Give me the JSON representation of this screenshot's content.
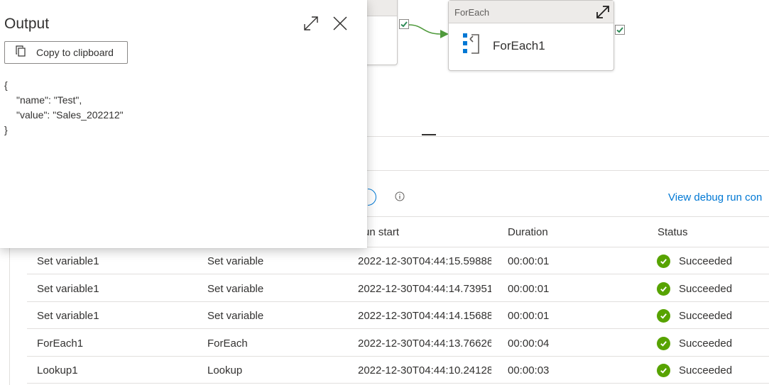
{
  "canvas": {
    "foreach_card": {
      "header_label": "ForEach",
      "activity_name": "ForEach1"
    },
    "connector_color": "#4f9a3c",
    "success_color": "#57a300"
  },
  "toolbar": {
    "debug_link": "View debug run con"
  },
  "table": {
    "headers": {
      "run_start": "un start",
      "duration": "Duration",
      "status": "Status"
    },
    "rows": [
      {
        "name": "Set variable1",
        "type": "Set variable",
        "run_start": "2022-12-30T04:44:15.59888",
        "duration": "00:00:01",
        "status": "Succeeded"
      },
      {
        "name": "Set variable1",
        "type": "Set variable",
        "run_start": "2022-12-30T04:44:14.73951",
        "duration": "00:00:01",
        "status": "Succeeded"
      },
      {
        "name": "Set variable1",
        "type": "Set variable",
        "run_start": "2022-12-30T04:44:14.15688",
        "duration": "00:00:01",
        "status": "Succeeded"
      },
      {
        "name": "ForEach1",
        "type": "ForEach",
        "run_start": "2022-12-30T04:44:13.76626",
        "duration": "00:00:04",
        "status": "Succeeded"
      },
      {
        "name": "Lookup1",
        "type": "Lookup",
        "run_start": "2022-12-30T04:44:10.24128",
        "duration": "00:00:03",
        "status": "Succeeded"
      }
    ]
  },
  "output_panel": {
    "title": "Output",
    "copy_label": "Copy to clipboard",
    "json_lines": {
      "open": "{",
      "line1": "\"name\": \"Test\",",
      "line2": "\"value\": \"Sales_202212\"",
      "close": "}"
    },
    "icons": {
      "expand": "expand-icon",
      "close": "close-icon",
      "copy": "copy-icon"
    }
  }
}
